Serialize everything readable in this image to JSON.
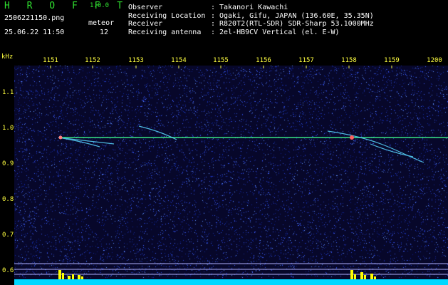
{
  "header": {
    "logo": "H R O F F T",
    "version": "1.0.0",
    "filename": "2506221150.png",
    "datetime": "25.06.22 11:50",
    "meteor_label": "meteor",
    "meteor_count": "12"
  },
  "info": [
    {
      "key": "Observer",
      "value": "Takanori Kawachi"
    },
    {
      "key": "Receiving Location",
      "value": "Ogaki, Gifu, JAPAN (136.60E, 35.35N)"
    },
    {
      "key": "Receiver",
      "value": "R820T2(RTL-SDR) SDR-Sharp 53.1000MHz"
    },
    {
      "key": "Receiving antenna",
      "value": "2el-HB9CV Vertical (el. E-W)"
    }
  ],
  "separator": ":",
  "axes": {
    "y_unit": "kHz",
    "x_ticks": [
      "1151",
      "1152",
      "1153",
      "1154",
      "1155",
      "1156",
      "1157",
      "1158",
      "1159",
      "1200"
    ],
    "y_ticks": [
      "1.1",
      "1.0",
      "0.9",
      "0.8",
      "0.7",
      "0.6"
    ]
  },
  "colors": {
    "background": "#000000",
    "waterfall": "#07072a",
    "carrier": "#40ff90",
    "histogram": "#ffff00",
    "baseline": "#00e0ff",
    "tick_text": "#ffff40",
    "logo": "#30e030"
  }
}
